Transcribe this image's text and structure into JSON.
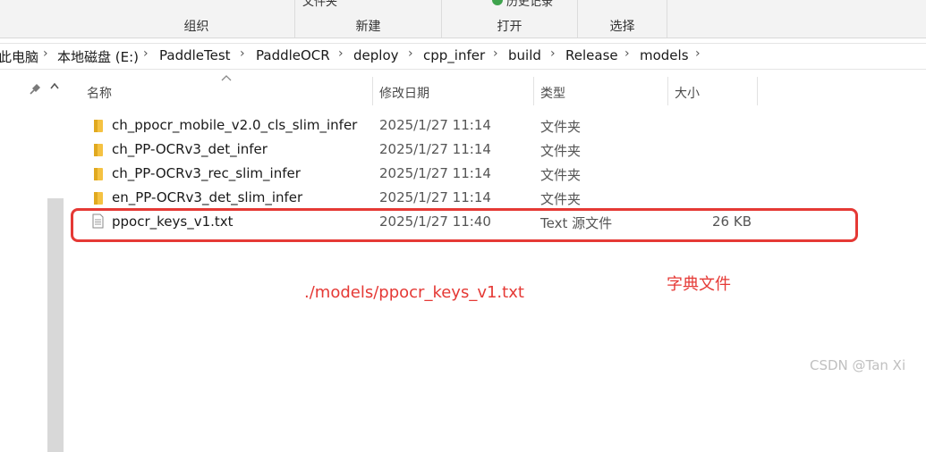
{
  "ribbon": {
    "groups": [
      {
        "label": "组织"
      },
      {
        "label": "新建",
        "top_text": "文件夹"
      },
      {
        "label": "打开",
        "top_text": "历史记录"
      },
      {
        "label": "选择"
      }
    ]
  },
  "address_bar": {
    "crumbs": [
      "此电脑",
      "本地磁盘 (E:)",
      "PaddleTest",
      "PaddleOCR",
      "deploy",
      "cpp_infer",
      "build",
      "Release",
      "models"
    ],
    "separator": "›"
  },
  "columns": {
    "name": "名称",
    "date": "修改日期",
    "type": "类型",
    "size": "大小"
  },
  "files": [
    {
      "name": "ch_ppocr_mobile_v2.0_cls_slim_infer",
      "date": "2025/1/27 11:14",
      "type": "文件夹",
      "size": "",
      "icon": "folder-icon"
    },
    {
      "name": "ch_PP-OCRv3_det_infer",
      "date": "2025/1/27 11:14",
      "type": "文件夹",
      "size": "",
      "icon": "folder-icon"
    },
    {
      "name": "ch_PP-OCRv3_rec_slim_infer",
      "date": "2025/1/27 11:14",
      "type": "文件夹",
      "size": "",
      "icon": "folder-icon"
    },
    {
      "name": "en_PP-OCRv3_det_slim_infer",
      "date": "2025/1/27 11:14",
      "type": "文件夹",
      "size": "",
      "icon": "folder-icon"
    },
    {
      "name": "ppocr_keys_v1.txt",
      "date": "2025/1/27 11:40",
      "type": "Text 源文件",
      "size": "26 KB",
      "icon": "text-file-icon"
    }
  ],
  "annotations": {
    "path_text": "./models/ppocr_keys_v1.txt",
    "dict_label": "字典文件",
    "color": "#e53935"
  },
  "watermark": "CSDN @Tan Xi"
}
